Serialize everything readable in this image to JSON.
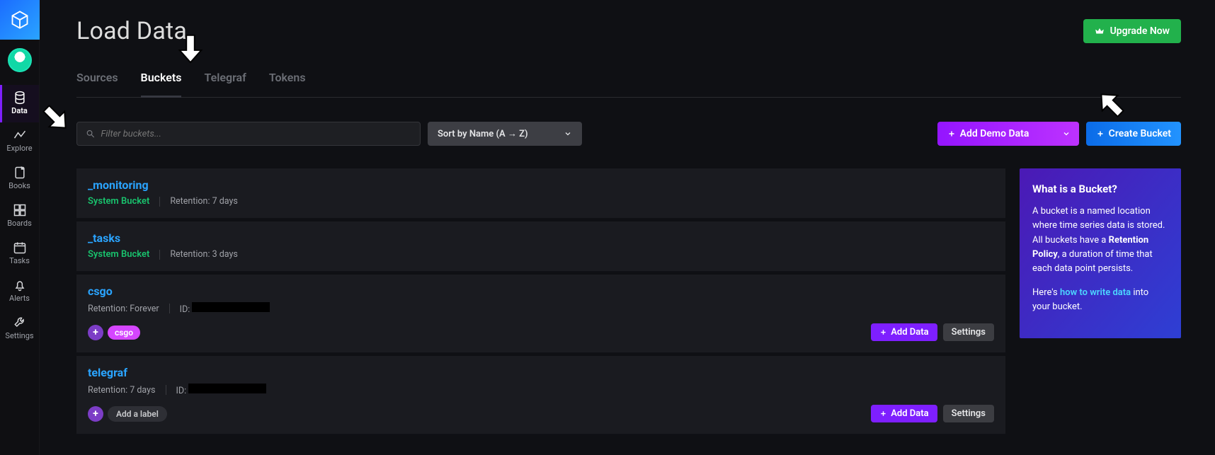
{
  "page": {
    "title": "Load Data"
  },
  "upgrade": {
    "label": "Upgrade Now"
  },
  "sidebar": {
    "items": [
      {
        "label": "Data"
      },
      {
        "label": "Explore"
      },
      {
        "label": "Books"
      },
      {
        "label": "Boards"
      },
      {
        "label": "Tasks"
      },
      {
        "label": "Alerts"
      },
      {
        "label": "Settings"
      }
    ]
  },
  "tabs": [
    {
      "label": "Sources"
    },
    {
      "label": "Buckets"
    },
    {
      "label": "Telegraf"
    },
    {
      "label": "Tokens"
    }
  ],
  "toolbar": {
    "search_placeholder": "Filter buckets...",
    "sort_label": "Sort by Name (A → Z)",
    "add_demo_label": "Add Demo Data",
    "create_label": "Create Bucket"
  },
  "buckets": [
    {
      "name": "_monitoring",
      "system_label": "System Bucket",
      "retention_label": "Retention: 7 days",
      "type": "system"
    },
    {
      "name": "_tasks",
      "system_label": "System Bucket",
      "retention_label": "Retention: 3 days",
      "type": "system"
    },
    {
      "name": "csgo",
      "retention_label": "Retention: Forever",
      "id_label": "ID:",
      "tags": [
        "csgo"
      ],
      "add_data_label": "Add Data",
      "settings_label": "Settings",
      "type": "user"
    },
    {
      "name": "telegraf",
      "retention_label": "Retention: 7 days",
      "id_label": "ID:",
      "add_label_text": "Add a label",
      "add_data_label": "Add Data",
      "settings_label": "Settings",
      "type": "user"
    }
  ],
  "infobox": {
    "heading": "What is a Bucket?",
    "p1a": "A bucket is a named location where time series data is stored. All buckets have a ",
    "p1b": "Retention Policy",
    "p1c": ", a duration of time that each data point persists.",
    "p2a": "Here's ",
    "p2link": "how to write data",
    "p2b": " into your bucket."
  }
}
